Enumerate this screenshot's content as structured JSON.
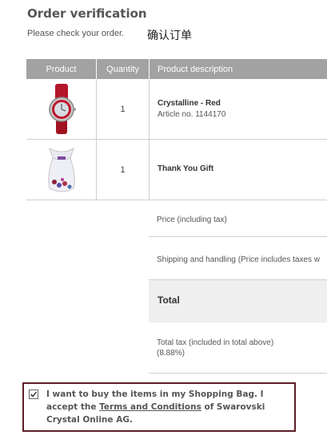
{
  "header": {
    "title": "Order verification",
    "subtitle": "Please check your order.",
    "cn_note": "确认订单"
  },
  "table": {
    "columns": [
      "Product",
      "Quantity",
      "Product description"
    ],
    "rows": [
      {
        "image": "red-watch-icon",
        "quantity": "1",
        "name": "Crystalline - Red",
        "article": "Article no. 1144170"
      },
      {
        "image": "gift-bag-icon",
        "quantity": "1",
        "name": "Thank You Gift",
        "article": ""
      }
    ]
  },
  "summary": {
    "price_label": "Price (including tax)",
    "shipping_label": "Shipping and handling (Price includes taxes w",
    "total_label": "Total",
    "tax_label_line1": "Total tax (included in total above)",
    "tax_label_line2": "(8.88%)"
  },
  "terms": {
    "checked": true,
    "text_before": "I want to buy the items in my Shopping Bag. I accept the ",
    "link_text": "Terms and Conditions",
    "text_after": " of Swarovski Crystal Online AG.",
    "border_color": "#5c1e28"
  }
}
